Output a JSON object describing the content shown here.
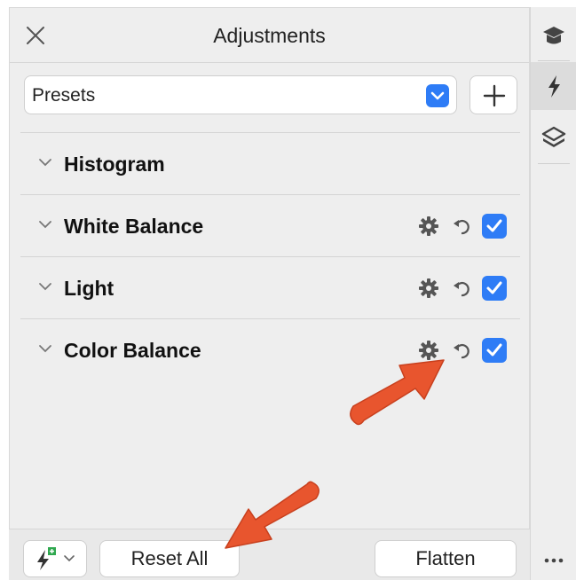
{
  "panel": {
    "title": "Adjustments",
    "close_icon": "close-icon"
  },
  "presets": {
    "selected": "Presets",
    "add_icon": "plus-icon"
  },
  "sections": [
    {
      "title": "Histogram",
      "has_tools": false
    },
    {
      "title": "White Balance",
      "has_tools": true,
      "enabled": true
    },
    {
      "title": "Light",
      "has_tools": true,
      "enabled": true
    },
    {
      "title": "Color Balance",
      "has_tools": true,
      "enabled": true
    }
  ],
  "footer": {
    "reset_label": "Reset All",
    "flatten_label": "Flatten",
    "auto_icon": "auto-adjust-icon"
  },
  "side_strip": {
    "items": [
      "graduation-cap-icon",
      "lightning-icon",
      "layers-icon"
    ],
    "active": "lightning-icon",
    "more_icon": "more-icon"
  },
  "colors": {
    "accent": "#2e7cf6",
    "annotation_arrow": "#e8552e"
  }
}
